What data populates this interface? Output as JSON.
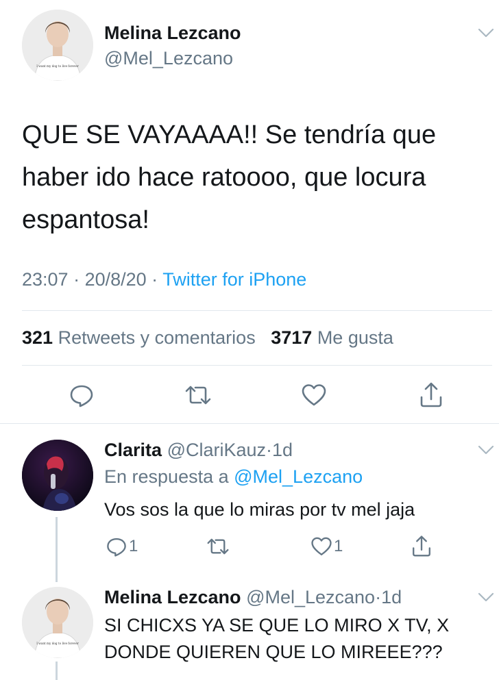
{
  "main_tweet": {
    "author_name": "Melina Lezcano",
    "author_handle": "@Mel_Lezcano",
    "text": "QUE SE VAYAAAA!! Se tendría que haber ido hace ratoooo, que locura espantosa!",
    "time": "23:07",
    "separator": " · ",
    "date": "20/8/20",
    "source": "Twitter for iPhone",
    "retweets_count": "321",
    "retweets_label": "Retweets y comentarios",
    "likes_count": "3717",
    "likes_label": "Me gusta",
    "avatar_shirt_text": "I want my dog to live forever"
  },
  "replies": [
    {
      "author_name": "Clarita",
      "author_handle": "@ClariKauz",
      "time": "1d",
      "in_reply_prefix": "En respuesta a ",
      "in_reply_to": "@Mel_Lezcano",
      "text": "Vos sos la que lo miras por tv mel jaja",
      "reply_count": "1",
      "retweet_count": "",
      "like_count": "1"
    },
    {
      "author_name": "Melina Lezcano",
      "author_handle": "@Mel_Lezcano",
      "time": "1d",
      "text": "SI CHICXS YA SE QUE LO MIRO X TV, X DONDE QUIEREN QUE LO MIREEE???",
      "avatar_shirt_text": "I want my dog to live forever"
    }
  ],
  "icons": {
    "chevron": "chevron-down-icon",
    "reply": "reply-icon",
    "retweet": "retweet-icon",
    "like": "like-icon",
    "share": "share-icon"
  },
  "colors": {
    "text": "#14171a",
    "secondary": "#657786",
    "accent": "#1da1f2",
    "divider": "#e1e8ed",
    "thread_line": "#ccd6dd"
  }
}
